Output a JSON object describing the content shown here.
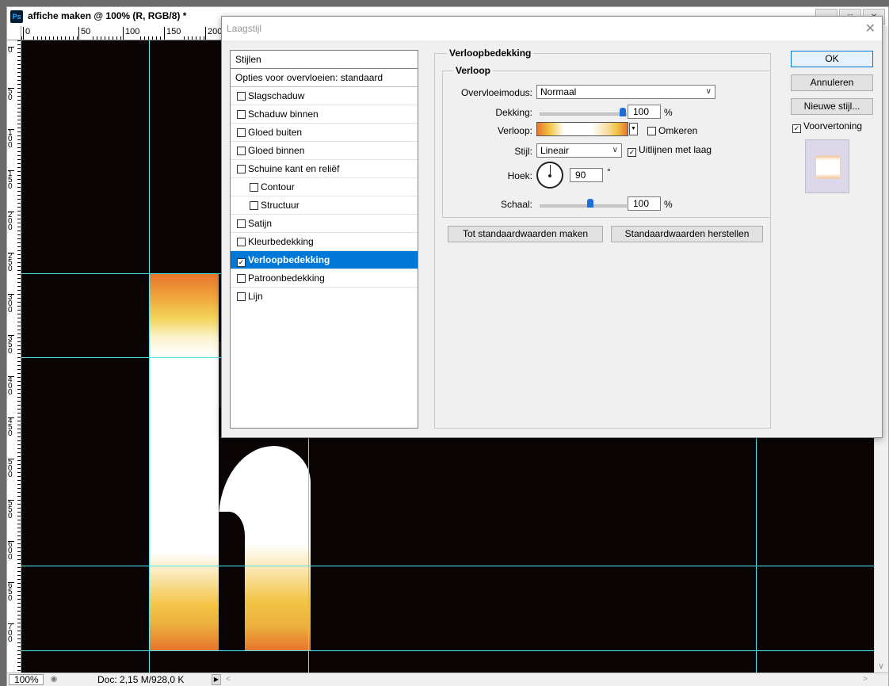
{
  "document": {
    "title": "affiche maken @ 100% (R, RGB/8) *",
    "app_badge": "Ps",
    "ruler_h_labels": [
      "0",
      "50",
      "100",
      "150",
      "200"
    ],
    "ruler_v_labels": [
      "0",
      "50",
      "100",
      "150",
      "200",
      "250",
      "300",
      "350",
      "400",
      "450",
      "500",
      "550",
      "600",
      "650",
      "700"
    ],
    "zoom": "100%",
    "doc_info": "Doc: 2,15 M/928,0 K"
  },
  "dialog": {
    "title": "Laagstijl",
    "styles_header": "Stijlen",
    "blending_options": "Opties voor overvloeien: standaard",
    "style_items": [
      {
        "label": "Slagschaduw",
        "checked": false,
        "indent": false
      },
      {
        "label": "Schaduw binnen",
        "checked": false,
        "indent": false
      },
      {
        "label": "Gloed buiten",
        "checked": false,
        "indent": false
      },
      {
        "label": "Gloed binnen",
        "checked": false,
        "indent": false
      },
      {
        "label": "Schuine kant en reliëf",
        "checked": false,
        "indent": false
      },
      {
        "label": "Contour",
        "checked": false,
        "indent": true
      },
      {
        "label": "Structuur",
        "checked": false,
        "indent": true
      },
      {
        "label": "Satijn",
        "checked": false,
        "indent": false
      },
      {
        "label": "Kleurbedekking",
        "checked": false,
        "indent": false
      },
      {
        "label": "Verloopbedekking",
        "checked": true,
        "indent": false,
        "selected": true
      },
      {
        "label": "Patroonbedekking",
        "checked": false,
        "indent": false
      },
      {
        "label": "Lijn",
        "checked": false,
        "indent": false
      }
    ],
    "section_title": "Verloopbedekking",
    "group_title": "Verloop",
    "blend_mode": {
      "label": "Overvloeimodus:",
      "value": "Normaal"
    },
    "opacity": {
      "label": "Dekking:",
      "value": "100",
      "unit": "%",
      "fraction": 1.0
    },
    "gradient": {
      "label": "Verloop:"
    },
    "reverse": {
      "label": "Omkeren",
      "checked": false
    },
    "style": {
      "label": "Stijl:",
      "value": "Lineair"
    },
    "align": {
      "label": "Uitlijnen met laag",
      "checked": true
    },
    "angle": {
      "label": "Hoek:",
      "value": "90",
      "unit": "°"
    },
    "scale": {
      "label": "Schaal:",
      "value": "100",
      "unit": "%"
    },
    "make_default_button": "Tot standaardwaarden maken",
    "reset_default_button": "Standaardwaarden herstellen",
    "ok_button": "OK",
    "cancel_button": "Annuleren",
    "new_style_button": "Nieuwe stijl...",
    "preview": {
      "label": "Voorvertoning",
      "checked": true
    }
  },
  "colors": {
    "guide": "#4ee5ef",
    "selection": "#0078d7",
    "gradient_orange": "#e8752e",
    "gradient_yellow": "#f2c545"
  },
  "icons": {
    "app": "photoshop-icon",
    "close": "close-icon",
    "dropdown": "chevron-down-icon",
    "check": "checkmark-icon"
  }
}
